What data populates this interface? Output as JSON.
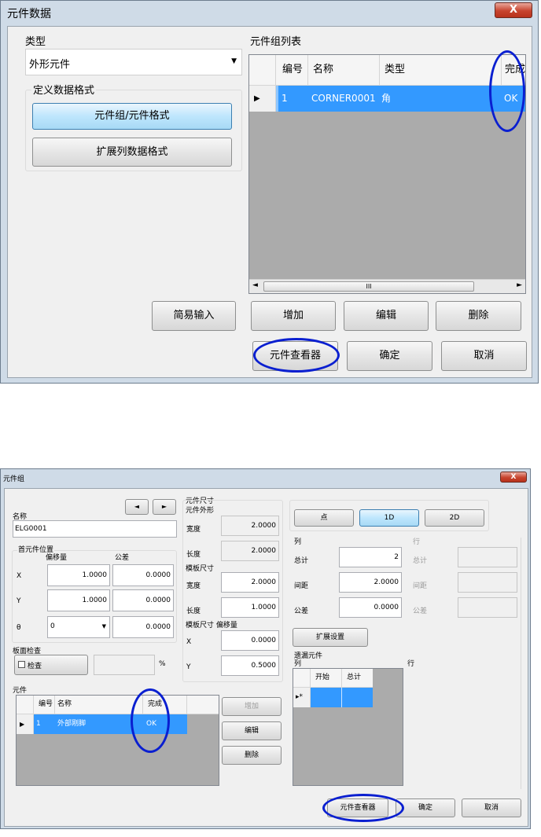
{
  "top_dialog": {
    "title": "元件数据",
    "close_label": "X",
    "type_label": "类型",
    "type_value": "外形元件",
    "format_group_label": "定义数据格式",
    "btn_component_format": "元件组/元件格式",
    "btn_extended_format": "扩展列数据格式",
    "list_label": "元件组列表",
    "table_headers": [
      "编号",
      "名称",
      "类型",
      "完成"
    ],
    "table_row": {
      "id": "1",
      "name": "CORNER0001",
      "type": "角",
      "done": "OK"
    },
    "scroll_mark": "III",
    "btn_simple_input": "简易输入",
    "btn_add": "增加",
    "btn_edit": "编辑",
    "btn_delete": "删除",
    "btn_viewer": "元件查看器",
    "btn_ok": "确定",
    "btn_cancel": "取消"
  },
  "bottom_dialog": {
    "title": "元件组",
    "close_label": "X",
    "name_label": "名称",
    "name_value": "ELG0001",
    "prev_icon": "◄",
    "next_icon": "►",
    "first_pos_label": "首元件位置",
    "offset_label": "偏移量",
    "tolerance_label": "公差",
    "x_label": "X",
    "y_label": "Y",
    "theta_label": "θ",
    "x_offset": "1.0000",
    "x_tol": "0.0000",
    "y_offset": "1.0000",
    "y_tol": "0.0000",
    "theta_value": "0",
    "theta_tol": "0.0000",
    "board_check_label": "板面检查",
    "check_label": "检查",
    "percent": "%",
    "elements_label": "元件",
    "table_headers": [
      "编号",
      "名称",
      "完成"
    ],
    "table_row": {
      "id": "1",
      "name": "外部刚脚",
      "done": "OK"
    },
    "btn_add": "增加",
    "btn_edit": "编辑",
    "btn_delete": "删除",
    "size_label": "元件尺寸",
    "outline_label": "元件外形",
    "width_label": "宽度",
    "width_value": "2.0000",
    "length_label": "长度",
    "length_value": "2.0000",
    "template_label": "模板尺寸",
    "tpl_width_label": "宽度",
    "tpl_width_value": "2.0000",
    "tpl_length_label": "长度",
    "tpl_length_value": "1.0000",
    "tpl_offset_label": "模板尺寸 偏移量",
    "tpl_x_label": "X",
    "tpl_x_value": "0.0000",
    "tpl_y_label": "Y",
    "tpl_y_value": "0.5000",
    "mode_point": "点",
    "mode_1d": "1D",
    "mode_2d": "2D",
    "col_label": "列",
    "row_label": "行",
    "total_label": "总计",
    "total_value": "2",
    "pitch_label": "间距",
    "pitch_value": "2.0000",
    "tol_label": "公差",
    "tol_value": "0.0000",
    "row_total_label": "总计",
    "row_pitch_label": "间距",
    "row_tol_label": "公差",
    "btn_extend_setting": "扩展设置",
    "skip_label": "遗漏元件",
    "skip_col_label": "列",
    "skip_row_label": "行",
    "skip_headers": [
      "开始",
      "总计"
    ],
    "skip_row_marker": "▸*",
    "btn_viewer": "元件查看器",
    "btn_ok": "确定",
    "btn_cancel": "取消"
  }
}
